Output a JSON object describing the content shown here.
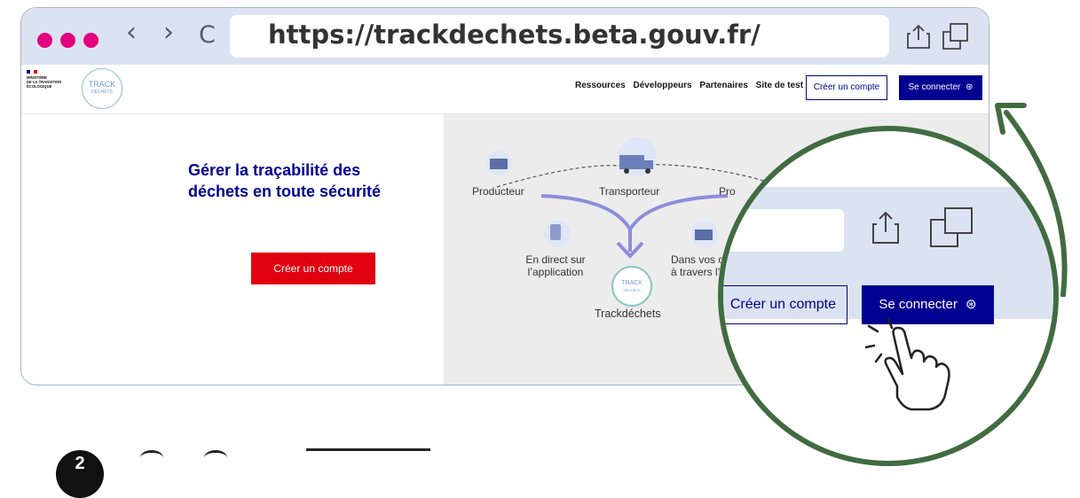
{
  "browser": {
    "url": "https://trackdechets.beta.gouv.fr/",
    "back_glyph": "‹",
    "forward_glyph": "›",
    "reload_glyph": "C",
    "window_dot_color": "#e4007c"
  },
  "site": {
    "ministry_lines": [
      "MINISTÈRE",
      "DE LA TRANSITION",
      "ÉCOLOGIQUE"
    ],
    "logo_text": "TRACK",
    "logo_subtext": "DÉCHETS",
    "nav": [
      "Ressources",
      "Développeurs",
      "Partenaires",
      "Site de test"
    ],
    "create_account": "Créer un compte",
    "login": "Se connecter",
    "login_icon": "user-circle-icon",
    "hero_title": "Gérer la traçabilité des déchets en toute sécurité",
    "hero_button": "Créer un compte",
    "diagram": {
      "producer": "Producteur",
      "transporter": "Transporteur",
      "third_partial": "Pro",
      "direct_line1": "En direct sur",
      "direct_line2": "l’application",
      "tools_line1": "Dans vos o",
      "tools_line2": "à travers l’A",
      "center": "Trackdéchets",
      "center_logo": "TRACK",
      "center_logo_sub": "DÉCHETS"
    }
  },
  "zoom": {
    "create_account": "Créer un compte",
    "login": "Se connecter"
  },
  "step": {
    "number": "2"
  },
  "colors": {
    "primary_blue": "#000091",
    "accent_red": "#e1000f",
    "arrow_green": "#416b41",
    "chrome_bg": "#dbe3f3"
  }
}
